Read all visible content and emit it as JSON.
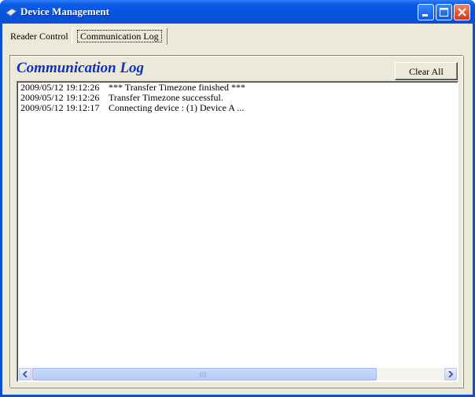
{
  "window": {
    "title": "Device Management",
    "icon": "device-app-icon"
  },
  "tabs": [
    {
      "label": "Reader Control",
      "active": false
    },
    {
      "label": "Communication Log",
      "active": true
    }
  ],
  "panel": {
    "title": "Communication Log",
    "clear_button": "Clear All"
  },
  "log": {
    "entries": [
      {
        "time": "2009/05/12 19:12:26",
        "message": "*** Transfer Timezone finished ***"
      },
      {
        "time": "2009/05/12 19:12:26",
        "message": "Transfer Timezone successful."
      },
      {
        "time": "2009/05/12 19:12:17",
        "message": "Connecting device : (1) Device A ..."
      }
    ]
  },
  "colors": {
    "title_bar": "#0653de",
    "panel_title": "#1030c0",
    "client_bg": "#ece9d8"
  }
}
